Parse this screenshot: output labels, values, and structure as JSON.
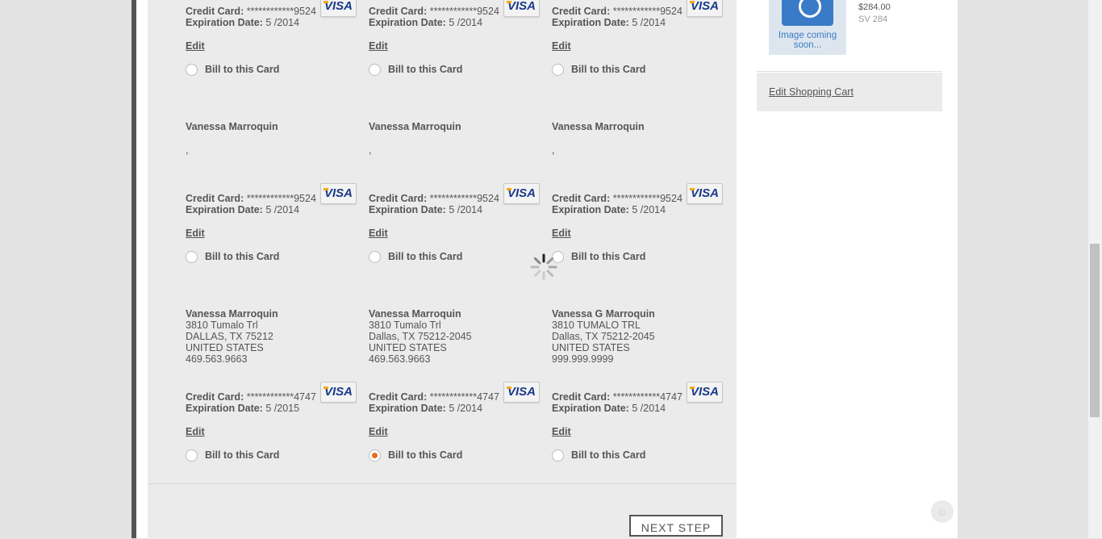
{
  "cards": [
    {
      "name": "",
      "address": [],
      "cc_label": "Credit Card:",
      "cc_number": "************9524",
      "exp_label": "Expiration Date:",
      "exp_value": "5 /2014",
      "edit": "Edit",
      "bill_label": "Bill to this Card",
      "selected": false
    },
    {
      "name": "",
      "address": [],
      "cc_label": "Credit Card:",
      "cc_number": "************9524",
      "exp_label": "Expiration Date:",
      "exp_value": "5 /2014",
      "edit": "Edit",
      "bill_label": "Bill to this Card",
      "selected": false
    },
    {
      "name": "",
      "address": [],
      "cc_label": "Credit Card:",
      "cc_number": "************9524",
      "exp_label": "Expiration Date:",
      "exp_value": "5 /2014",
      "edit": "Edit",
      "bill_label": "Bill to this Card",
      "selected": false
    },
    {
      "name": "Vanessa Marroquin",
      "address": [
        ","
      ],
      "cc_label": "Credit Card:",
      "cc_number": "************9524",
      "exp_label": "Expiration Date:",
      "exp_value": "5 /2014",
      "edit": "Edit",
      "bill_label": "Bill to this Card",
      "selected": false
    },
    {
      "name": "Vanessa Marroquin",
      "address": [
        ","
      ],
      "cc_label": "Credit Card:",
      "cc_number": "************9524",
      "exp_label": "Expiration Date:",
      "exp_value": "5 /2014",
      "edit": "Edit",
      "bill_label": "Bill to this Card",
      "selected": false
    },
    {
      "name": "Vanessa Marroquin",
      "address": [
        ","
      ],
      "cc_label": "Credit Card:",
      "cc_number": "************9524",
      "exp_label": "Expiration Date:",
      "exp_value": "5 /2014",
      "edit": "Edit",
      "bill_label": "Bill to this Card",
      "selected": false
    },
    {
      "name": "Vanessa Marroquin",
      "address": [
        "3810 Tumalo Trl",
        "DALLAS, TX 75212",
        "UNITED STATES",
        "469.563.9663"
      ],
      "cc_label": "Credit Card:",
      "cc_number": "************4747",
      "exp_label": "Expiration Date:",
      "exp_value": "5 /2015",
      "edit": "Edit",
      "bill_label": "Bill to this Card",
      "selected": false
    },
    {
      "name": "Vanessa Marroquin",
      "address": [
        "3810 Tumalo Trl",
        "Dallas, TX 75212-2045",
        "UNITED STATES",
        "469.563.9663"
      ],
      "cc_label": "Credit Card:",
      "cc_number": "************4747",
      "exp_label": "Expiration Date:",
      "exp_value": "5 /2014",
      "edit": "Edit",
      "bill_label": "Bill to this Card",
      "selected": true
    },
    {
      "name": "Vanessa G Marroquin",
      "address": [
        "3810 TUMALO TRL",
        "Dallas, TX 75212-2045",
        "UNITED STATES",
        "999.999.9999"
      ],
      "cc_label": "Credit Card:",
      "cc_number": "************4747",
      "exp_label": "Expiration Date:",
      "exp_value": "5 /2014",
      "edit": "Edit",
      "bill_label": "Bill to this Card",
      "selected": false
    }
  ],
  "card_brand": "VISA",
  "next_step": "NEXT STEP",
  "sidebar": {
    "image_text": "Image coming soon...",
    "price": "$284.00",
    "sv": "SV 284",
    "edit_cart": "Edit Shopping Cart"
  },
  "colors": {
    "accent": "#e56d1f",
    "visa_blue": "#1a3a8a",
    "image_blue": "#3a7bc8"
  }
}
